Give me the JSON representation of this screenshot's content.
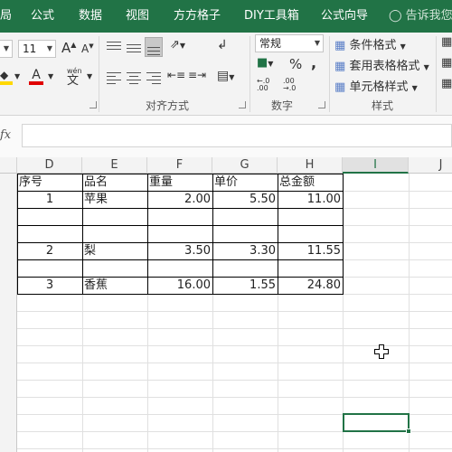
{
  "ribbon_tabs": [
    "局",
    "公式",
    "数据",
    "视图",
    "方方格子",
    "DIY工具箱",
    "公式向导"
  ],
  "tell_me": "告诉我您想",
  "font_size": "11",
  "font_grow": "A",
  "font_shrink": "A",
  "font_color_label": "A",
  "phonetic_label": "wén",
  "number_format": "常规",
  "percent_symbol": "%",
  "comma_symbol": ",",
  "decimal_increase": "←.0\n.00",
  "decimal_decrease": ".00\n→.0",
  "styles": {
    "conditional": "条件格式",
    "table": "套用表格格式",
    "cell": "单元格样式"
  },
  "groups": {
    "alignment": "对齐方式",
    "number": "数字",
    "styles": "样式"
  },
  "fx_label": "fx",
  "formula_value": "",
  "columns": [
    "D",
    "E",
    "F",
    "G",
    "H",
    "I",
    "J"
  ],
  "selected_column": "I",
  "table": {
    "headers": [
      "序号",
      "品名",
      "重量",
      "单价",
      "总金额"
    ],
    "rows": [
      [
        "1",
        "苹果",
        "2.00",
        "5.50",
        "11.00"
      ],
      [
        "",
        "",
        "",
        "",
        ""
      ],
      [
        "",
        "",
        "",
        "",
        ""
      ],
      [
        "2",
        "梨",
        "3.50",
        "3.30",
        "11.55"
      ],
      [
        "",
        "",
        "",
        "",
        ""
      ],
      [
        "3",
        "香蕉",
        "16.00",
        "1.55",
        "24.80"
      ]
    ]
  },
  "colors": {
    "excel_green": "#217346",
    "font_color_bar": "#e00000",
    "fill_color_bar": "#ffd800"
  }
}
